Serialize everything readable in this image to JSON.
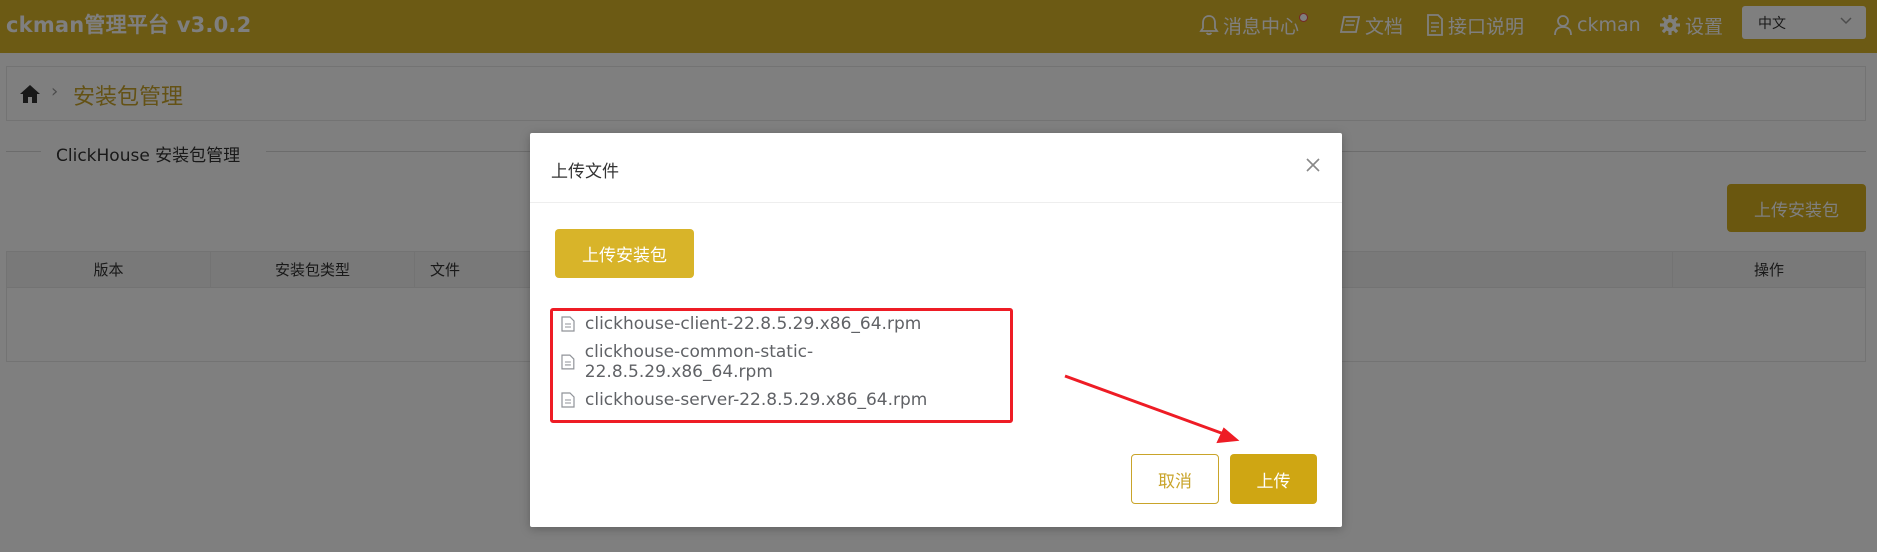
{
  "header": {
    "brand": "ckman管理平台 v3.0.2",
    "nav": {
      "messages": "消息中心",
      "docs": "文档",
      "api": "接口说明",
      "user": "ckman",
      "settings": "设置"
    },
    "language": "中文"
  },
  "breadcrumb": {
    "title": "安装包管理"
  },
  "section": {
    "title": "ClickHouse 安装包管理"
  },
  "page_upload_button": "上传安装包",
  "table": {
    "columns": [
      "版本",
      "安装包类型",
      "文件",
      "操作"
    ]
  },
  "dialog": {
    "title": "上传文件",
    "upload_button": "上传安装包",
    "files": [
      "clickhouse-client-22.8.5.29.x86_64.rpm",
      "clickhouse-common-static-22.8.5.29.x86_64.rpm",
      "clickhouse-server-22.8.5.29.x86_64.rpm"
    ],
    "cancel": "取消",
    "submit": "上传"
  },
  "colors": {
    "header": "#d8b429",
    "accent": "#c9a42a",
    "annotation": "#ee1c25"
  }
}
